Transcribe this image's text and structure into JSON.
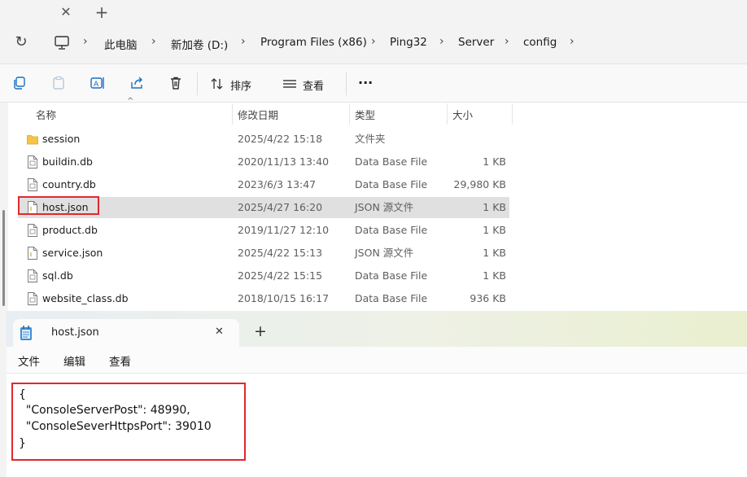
{
  "tabstrip": {
    "close_glyph": "✕",
    "new_tab_glyph": "+"
  },
  "address": {
    "refresh_glyph": "↻",
    "crumbs": [
      "此电脑",
      "新加卷 (D:)",
      "Program Files (x86)",
      "Ping32",
      "Server",
      "config"
    ]
  },
  "toolbar": {
    "sort_label": "排序",
    "view_label": "查看",
    "more_glyph": "···"
  },
  "columns": {
    "name": "名称",
    "date": "修改日期",
    "type": "类型",
    "size": "大小"
  },
  "files": [
    {
      "name": "session",
      "date": "2025/4/22 15:18",
      "type": "文件夹",
      "size": "",
      "icon": "folder-icon"
    },
    {
      "name": "buildin.db",
      "date": "2020/11/13 13:40",
      "type": "Data Base File",
      "size": "1 KB",
      "icon": "file-icon"
    },
    {
      "name": "country.db",
      "date": "2023/6/3 13:47",
      "type": "Data Base File",
      "size": "29,980 KB",
      "icon": "file-icon"
    },
    {
      "name": "host.json",
      "date": "2025/4/27 16:20",
      "type": "JSON 源文件",
      "size": "1 KB",
      "icon": "json-file-icon"
    },
    {
      "name": "product.db",
      "date": "2019/11/27 12:10",
      "type": "Data Base File",
      "size": "1 KB",
      "icon": "file-icon"
    },
    {
      "name": "service.json",
      "date": "2025/4/22 15:13",
      "type": "JSON 源文件",
      "size": "1 KB",
      "icon": "json-file-icon"
    },
    {
      "name": "sql.db",
      "date": "2025/4/22 15:15",
      "type": "Data Base File",
      "size": "1 KB",
      "icon": "file-icon"
    },
    {
      "name": "website_class.db",
      "date": "2018/10/15 16:17",
      "type": "Data Base File",
      "size": "936 KB",
      "icon": "file-icon"
    }
  ],
  "notepad": {
    "tab_title": "host.json",
    "close_glyph": "✕",
    "new_tab_glyph": "+",
    "menu": {
      "file": "文件",
      "edit": "编辑",
      "view": "查看"
    },
    "lines": [
      "{",
      "  \"ConsoleServerPost\": 48990,",
      "  \"ConsoleSeverHttpsPort\": 39010",
      "}"
    ]
  },
  "colors": {
    "highlight_border": "#e0282f",
    "selected_row": "#e0e0e0",
    "folder": "#f4c542"
  }
}
